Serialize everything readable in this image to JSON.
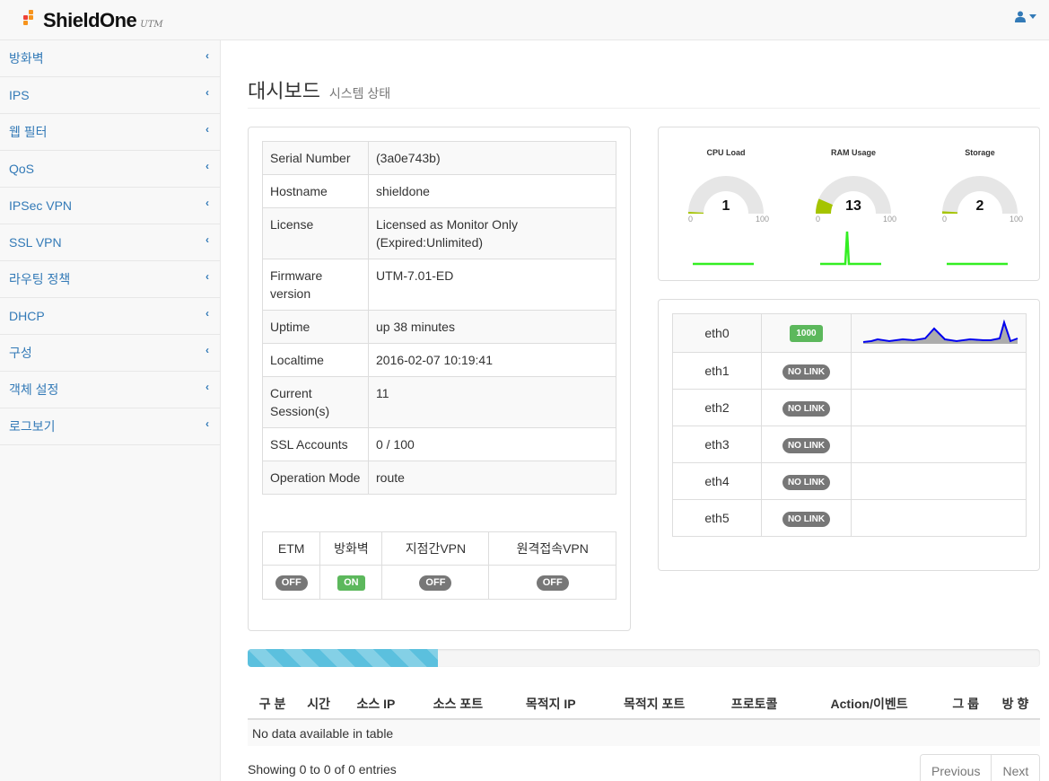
{
  "app": {
    "brand": "ShieldOne",
    "brand_sub": "UTM",
    "brand_dot_colors": [
      "#f7941d",
      "#ef4136",
      "#f7941d"
    ]
  },
  "sidebar": {
    "items": [
      {
        "label": "방화벽"
      },
      {
        "label": "IPS"
      },
      {
        "label": "웹 필터"
      },
      {
        "label": "QoS"
      },
      {
        "label": "IPSec VPN"
      },
      {
        "label": "SSL VPN"
      },
      {
        "label": "라우팅 정책"
      },
      {
        "label": "DHCP"
      },
      {
        "label": "구성"
      },
      {
        "label": "객체 설정"
      },
      {
        "label": "로그보기"
      }
    ],
    "chevron": "‹"
  },
  "header": {
    "title": "대시보드",
    "subtitle": "시스템 상태"
  },
  "system_info": [
    {
      "key": "Serial Number",
      "value": "(3a0e743b)"
    },
    {
      "key": "Hostname",
      "value": "shieldone"
    },
    {
      "key": "License",
      "value": "Licensed as Monitor Only (Expired:Unlimited)"
    },
    {
      "key": "Firmware version",
      "value": "UTM-7.01-ED"
    },
    {
      "key": "Uptime",
      "value": "up 38 minutes"
    },
    {
      "key": "Localtime",
      "value": "2016-02-07 10:19:41"
    },
    {
      "key": "Current Session(s)",
      "value": "11"
    },
    {
      "key": "SSL Accounts",
      "value": "0 / 100"
    },
    {
      "key": "Operation Mode",
      "value": "route"
    }
  ],
  "features": [
    {
      "name": "ETM",
      "status": "OFF"
    },
    {
      "name": "방화벽",
      "status": "ON"
    },
    {
      "name": "지점간VPN",
      "status": "OFF"
    },
    {
      "name": "원격접속VPN",
      "status": "OFF"
    }
  ],
  "gauges": [
    {
      "label": "CPU Load",
      "value": "1",
      "min": "0",
      "max": "100",
      "level": 1
    },
    {
      "label": "RAM Usage",
      "value": "13",
      "min": "0",
      "max": "100",
      "level": 13
    },
    {
      "label": "Storage",
      "value": "2",
      "min": "0",
      "max": "100",
      "level": 2
    }
  ],
  "interfaces": [
    {
      "name": "eth0",
      "status": "1000"
    },
    {
      "name": "eth1",
      "status": "NO LINK"
    },
    {
      "name": "eth2",
      "status": "NO LINK"
    },
    {
      "name": "eth3",
      "status": "NO LINK"
    },
    {
      "name": "eth4",
      "status": "NO LINK"
    },
    {
      "name": "eth5",
      "status": "NO LINK"
    }
  ],
  "progress": {
    "percent": 24
  },
  "log_table": {
    "columns": [
      "구 분",
      "시간",
      "소스 IP",
      "소스 포트",
      "목적지 IP",
      "목적지 포트",
      "프로토콜",
      "Action/이벤트",
      "그 룹",
      "방 향"
    ],
    "empty_text": "No data available in table",
    "info": "Showing 0 to 0 of 0 entries",
    "prev": "Previous",
    "next": "Next"
  },
  "colors": {
    "link": "#337ab7",
    "gauge_fill": "#a5c400",
    "spark_green": "#33ee22",
    "traffic_line": "#0000ee"
  }
}
